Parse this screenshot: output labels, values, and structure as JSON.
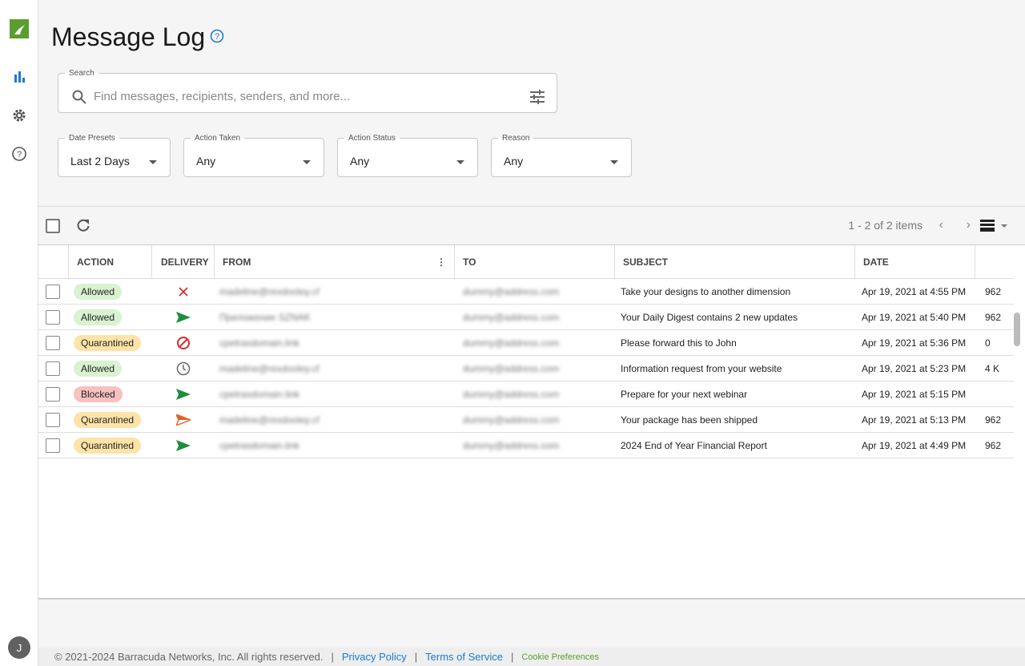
{
  "header": {
    "title": "Message Log"
  },
  "search": {
    "label": "Search",
    "placeholder": "Find messages, recipients, senders, and more..."
  },
  "filters": [
    {
      "label": "Date Presets",
      "value": "Last 2 Days"
    },
    {
      "label": "Action Taken",
      "value": "Any"
    },
    {
      "label": "Action Status",
      "value": "Any"
    },
    {
      "label": "Reason",
      "value": "Any"
    }
  ],
  "pagination": {
    "text": "1 - 2 of 2 items"
  },
  "columns": [
    "ACTION",
    "DELIVERY",
    "FROM",
    "TO",
    "SUBJECT",
    "DATE"
  ],
  "colors": {
    "allowed": "#d9f2d0",
    "quarantined": "#fde3a7",
    "blocked": "#f8c0c0",
    "accent": "#1a7bd0",
    "brand": "#5a9e2f"
  },
  "rows": [
    {
      "action": "Allowed",
      "delivery": "x-icon",
      "from": "madeline@rexdooley.cf",
      "to": "dummy@address.com",
      "subject": "Take your designs to another dimension",
      "date": "Apr 19, 2021 at 4:55 PM",
      "size": "962"
    },
    {
      "action": "Allowed",
      "delivery": "send-icon",
      "from": "Приложение SZNAK",
      "to": "dummy@address.com",
      "subject": "Your Daily Digest contains 2 new updates",
      "date": "Apr 19, 2021 at 5:40 PM",
      "size": "962"
    },
    {
      "action": "Quarantined",
      "delivery": "blocked-icon",
      "from": "cpetrasdomain.link",
      "to": "dummy@address.com",
      "subject": "Please forward this to John",
      "date": "Apr 19, 2021 at 5:36 PM",
      "size": "0"
    },
    {
      "action": "Allowed",
      "delivery": "clock-icon",
      "from": "madeline@rexdooley.cf",
      "to": "dummy@address.com",
      "subject": "Information request from your website",
      "date": "Apr 19, 2021 at 5:23 PM",
      "size": "4 K"
    },
    {
      "action": "Blocked",
      "delivery": "send-icon",
      "from": "cpetrasdomain.link",
      "to": "dummy@address.com",
      "subject": "Prepare for your next webinar",
      "date": "Apr 19, 2021 at 5:15 PM",
      "size": ""
    },
    {
      "action": "Quarantined",
      "delivery": "send-outline-icon",
      "from": "madeline@rexdooley.cf",
      "to": "dummy@address.com",
      "subject": "Your package has been shipped",
      "date": "Apr 19, 2021 at 5:13 PM",
      "size": "962"
    },
    {
      "action": "Quarantined",
      "delivery": "send-icon",
      "from": "cpetrasdomain.link",
      "to": "dummy@address.com",
      "subject": "2024 End of Year Financial Report",
      "date": "Apr 19, 2021 at 4:49 PM",
      "size": "962"
    }
  ],
  "user": {
    "initial": "J"
  },
  "footer": {
    "copyright": "© 2021-2024 Barracuda Networks, Inc. All rights reserved.",
    "sep": "|",
    "privacy": "Privacy Policy",
    "terms": "Terms of Service",
    "cookies": "Cookie Preferences"
  }
}
